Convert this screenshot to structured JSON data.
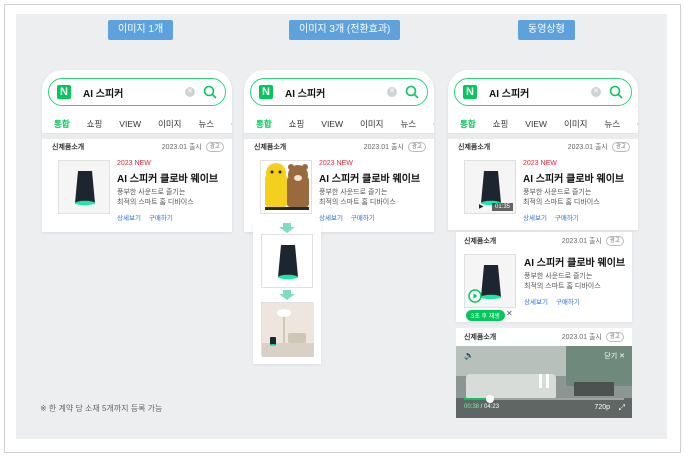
{
  "labels": {
    "single": "이미지 1개",
    "triple": "이미지 3개 (전환효과)",
    "video": "동영상형"
  },
  "search": {
    "query": "AI 스피커",
    "logo": "N"
  },
  "tabs": [
    "통합",
    "쇼핑",
    "VIEW",
    "이미지",
    "뉴스"
  ],
  "more": "•••",
  "product": {
    "section": "신제품소개",
    "date": "2023.01 출시",
    "ad": "광고",
    "badge": "2023 NEW",
    "name": "AI 스피커 클로바 웨이브",
    "desc1": "풍부한 사운드로 즐기는",
    "desc2": "최적의 스마트 홈 디바이스",
    "link_detail": "상세보기",
    "link_buy": "구매하기"
  },
  "video": {
    "duration": "01:35",
    "replay": "3초 후 재생",
    "close": "✕",
    "fold": "닫기 ✕",
    "time_current": "00:38",
    "time_total": "04:23",
    "quality": "720p",
    "progress": 0.16
  },
  "note": "※ 한 계약 당 소재 5개까지 등록 가능",
  "colors": {
    "accent": "#03c75a",
    "pill": "#5ea2dd",
    "new": "#e0283a",
    "link": "#2a6fd6"
  }
}
